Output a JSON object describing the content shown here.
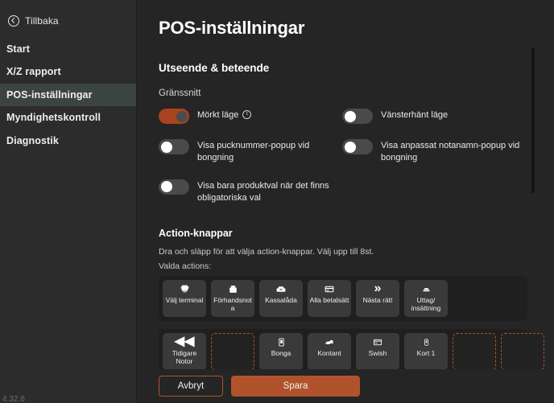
{
  "sidebar": {
    "back_label": "Tillbaka",
    "back_icon": "circle-arrow-left-icon",
    "items": [
      {
        "label": "Start",
        "active": false
      },
      {
        "label": "X/Z rapport",
        "active": false
      },
      {
        "label": "POS-inställningar",
        "active": true
      },
      {
        "label": "Myndighetskontroll",
        "active": false
      },
      {
        "label": "Diagnostik",
        "active": false
      }
    ],
    "version": "4.32.6"
  },
  "main": {
    "page_title": "POS-inställningar",
    "section_title": "Utseende & beteende",
    "sub_title": "Gränssnitt",
    "toggles": [
      {
        "label": "Mörkt läge",
        "on": true,
        "has_info": true
      },
      {
        "label": "Vänsterhänt läge",
        "on": false,
        "has_info": false
      },
      {
        "label": "Visa pucknummer-popup vid bongning",
        "on": false,
        "has_info": false
      },
      {
        "label": "Visa anpassat notanamn-popup vid bongning",
        "on": false,
        "has_info": false
      },
      {
        "label": "Visa bara produktval när det finns obligatoriska val",
        "on": false,
        "has_info": false
      }
    ],
    "actions": {
      "heading": "Action-knappar",
      "description": "Dra och släpp för att välja action-knappar. Välj upp till 8st.",
      "selected_label": "Valda actions:",
      "row1": [
        {
          "label": "Välj terminal",
          "icon": "terminal-icon",
          "type": "button"
        },
        {
          "label": "Förhandsnota",
          "icon": "receipt-preview-icon",
          "type": "button"
        },
        {
          "label": "Kassalåda",
          "icon": "cash-drawer-icon",
          "type": "button"
        },
        {
          "label": "Alla betalsätt",
          "icon": "payment-methods-icon",
          "type": "button"
        },
        {
          "label": "Nästa rätt",
          "icon": "double-chevron-right-icon",
          "type": "button"
        },
        {
          "label": "Uttag/ insättning",
          "icon": "cash-inout-icon",
          "type": "button"
        }
      ],
      "row2": [
        {
          "label": "Tidigare Notor",
          "icon": "double-chevron-left-icon",
          "type": "button"
        },
        {
          "label": "",
          "icon": "",
          "type": "slot"
        },
        {
          "label": "Bonga",
          "icon": "tablet-order-icon",
          "type": "button"
        },
        {
          "label": "Kontant",
          "icon": "cash-icon",
          "type": "button"
        },
        {
          "label": "Swish",
          "icon": "card-icon",
          "type": "button"
        },
        {
          "label": "Kort 1",
          "icon": "phone-icon",
          "type": "button"
        },
        {
          "label": "",
          "icon": "",
          "type": "slot"
        },
        {
          "label": "",
          "icon": "",
          "type": "slot"
        }
      ]
    },
    "footer": {
      "cancel_label": "Avbryt",
      "save_label": "Spara"
    }
  },
  "colors": {
    "accent": "#b0532c",
    "toggle_on": "#a8441f",
    "sidebar_bg": "#2c2c2c",
    "main_bg": "#252525",
    "active_nav": "#3b4440",
    "button_bg": "#3a3a3a"
  }
}
